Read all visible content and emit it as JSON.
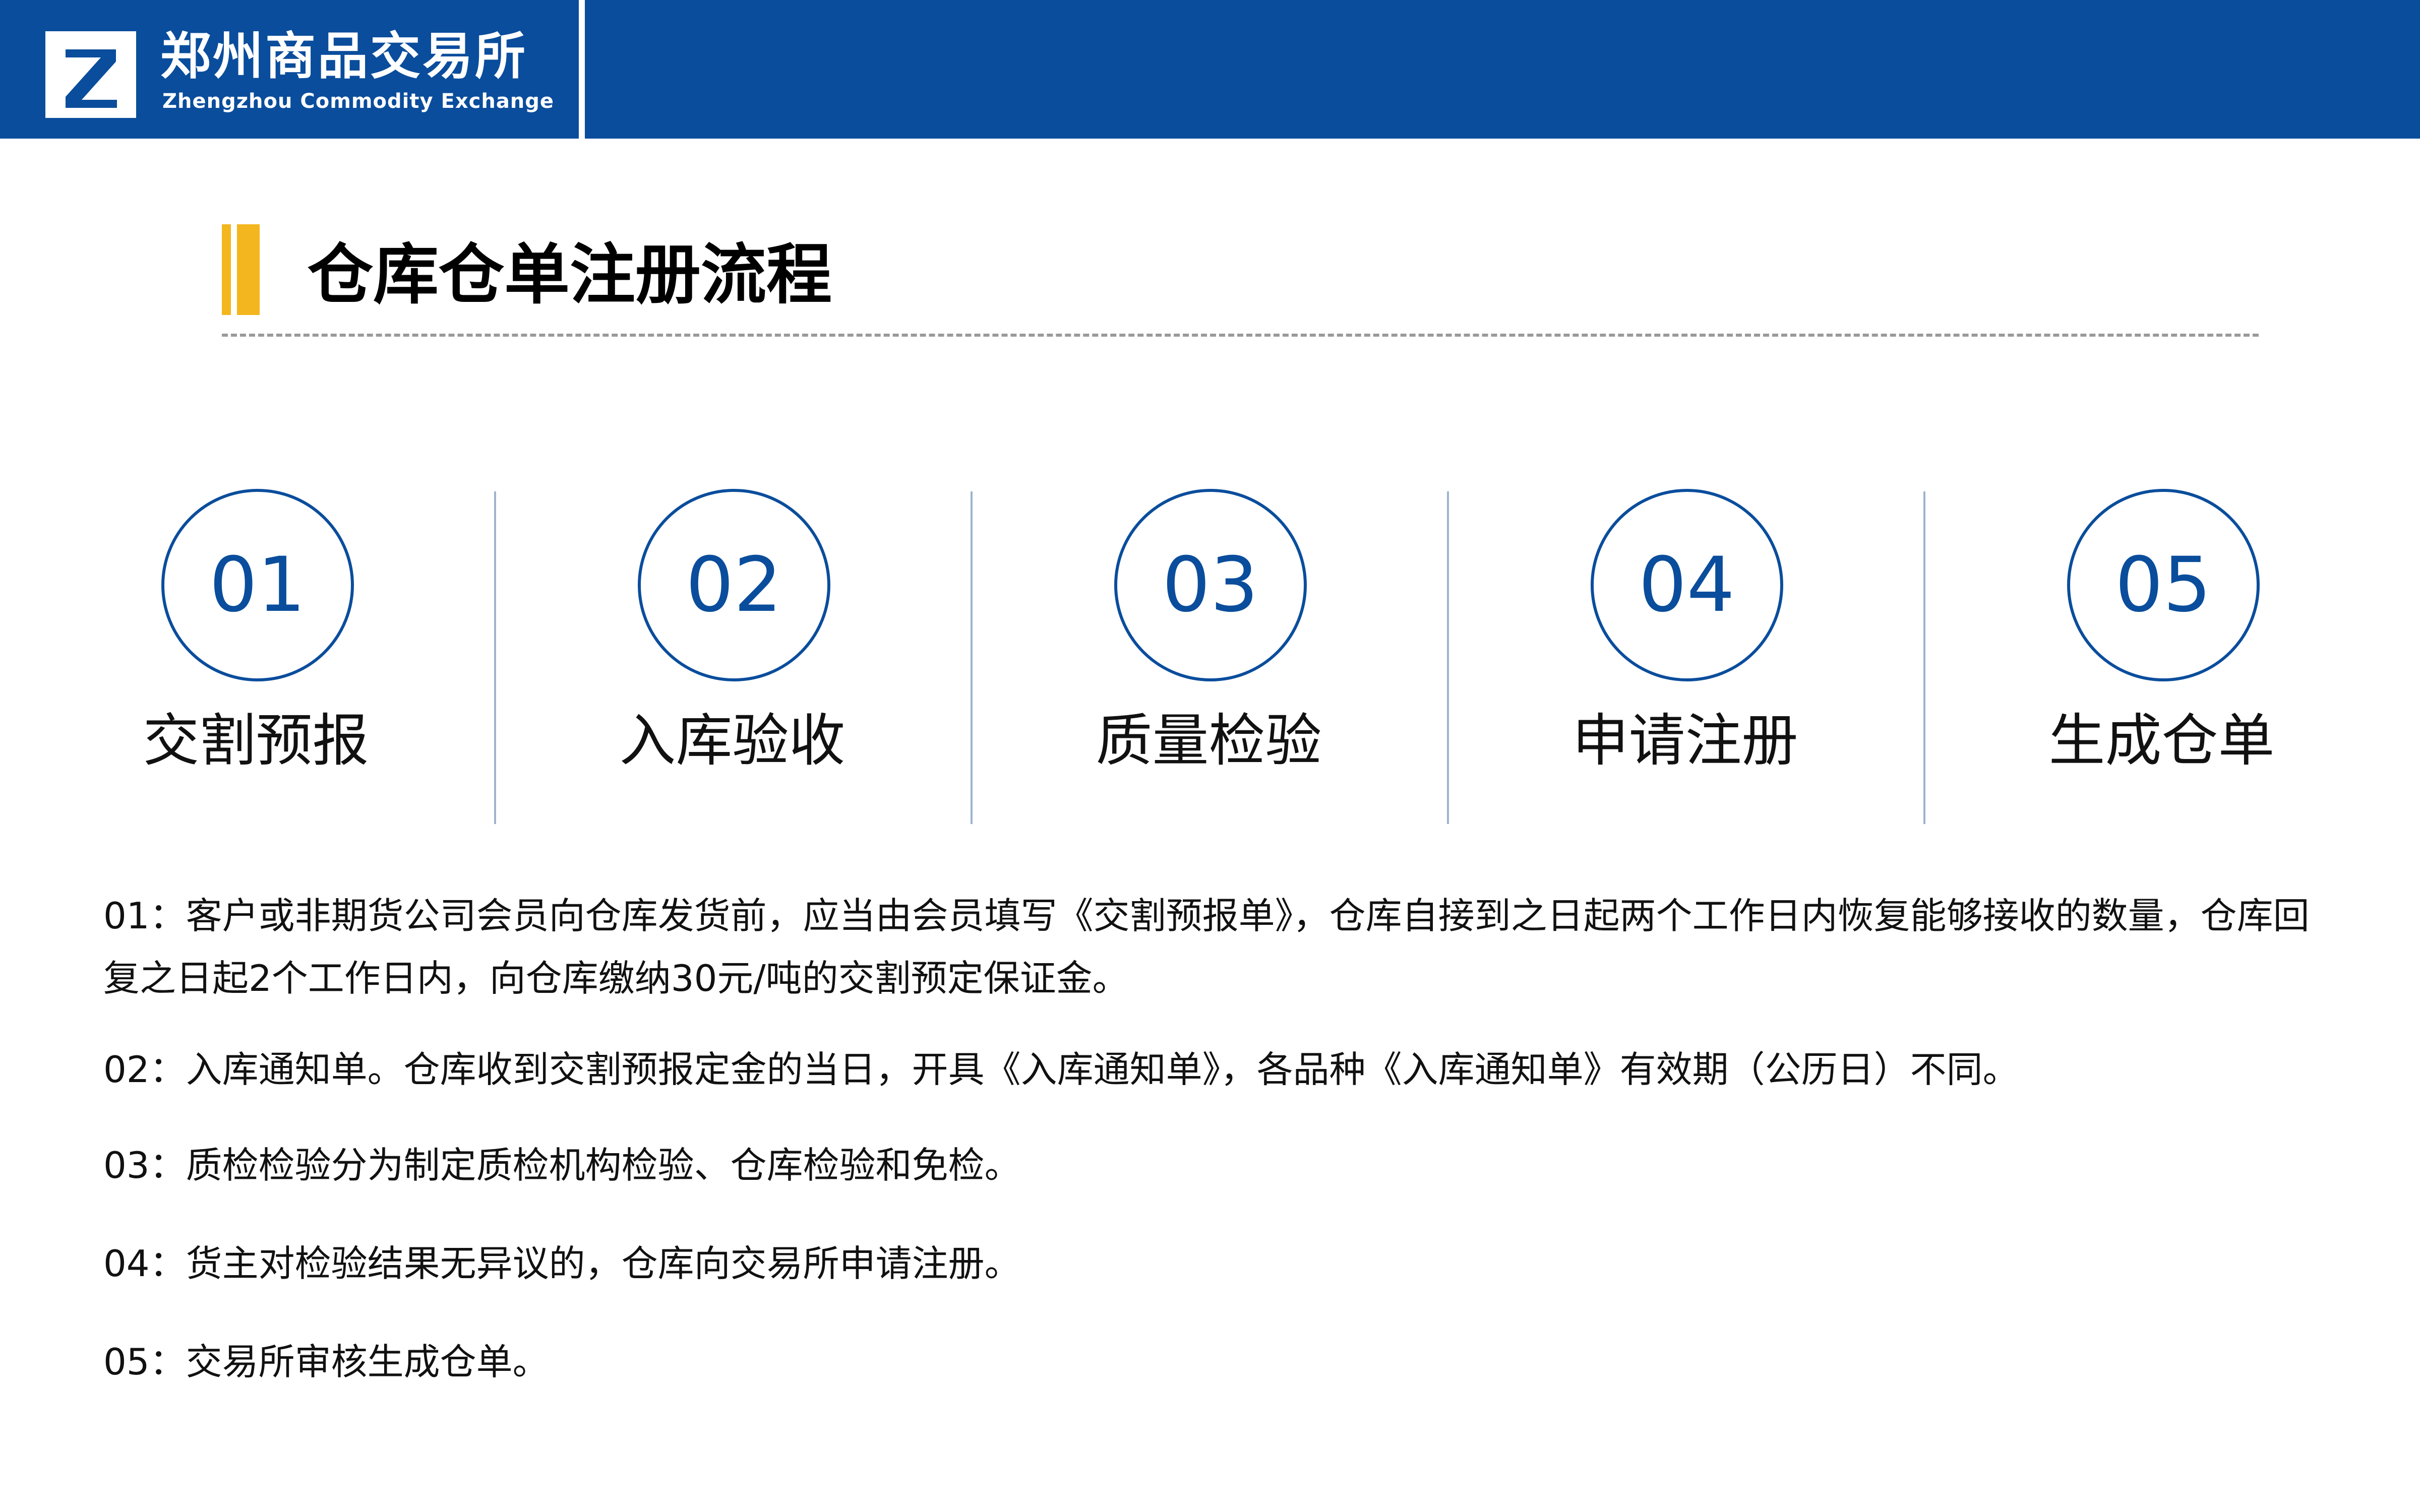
{
  "header": {
    "brand_cn": "郑州商品交易所",
    "brand_en": "Zhengzhou Commodity Exchange",
    "brand_color": "#0a4d9c"
  },
  "section": {
    "title": "仓库仓单注册流程",
    "accent_color": "#f3b61f"
  },
  "steps": [
    {
      "number": "01",
      "label": "交割预报"
    },
    {
      "number": "02",
      "label": "入库验收"
    },
    {
      "number": "03",
      "label": "质量检验"
    },
    {
      "number": "04",
      "label": "申请注册"
    },
    {
      "number": "05",
      "label": "生成仓单"
    }
  ],
  "descriptions": [
    "01：客户或非期货公司会员向仓库发货前，应当由会员填写《交割预报单》，仓库自接到之日起两个工作日内恢复能够接收的数量，仓库回复之日起2个工作日内，向仓库缴纳30元/吨的交割预定保证金。",
    "02：入库通知单。仓库收到交割预报定金的当日，开具《入库通知单》，各品种《入库通知单》有效期（公历日）不同。",
    "03：质检检验分为制定质检机构检验、仓库检验和免检。",
    "04：货主对检验结果无异议的，仓库向交易所申请注册。",
    "05：交易所审核生成仓单。"
  ],
  "icons": {
    "logo": "zce-logo-icon"
  }
}
